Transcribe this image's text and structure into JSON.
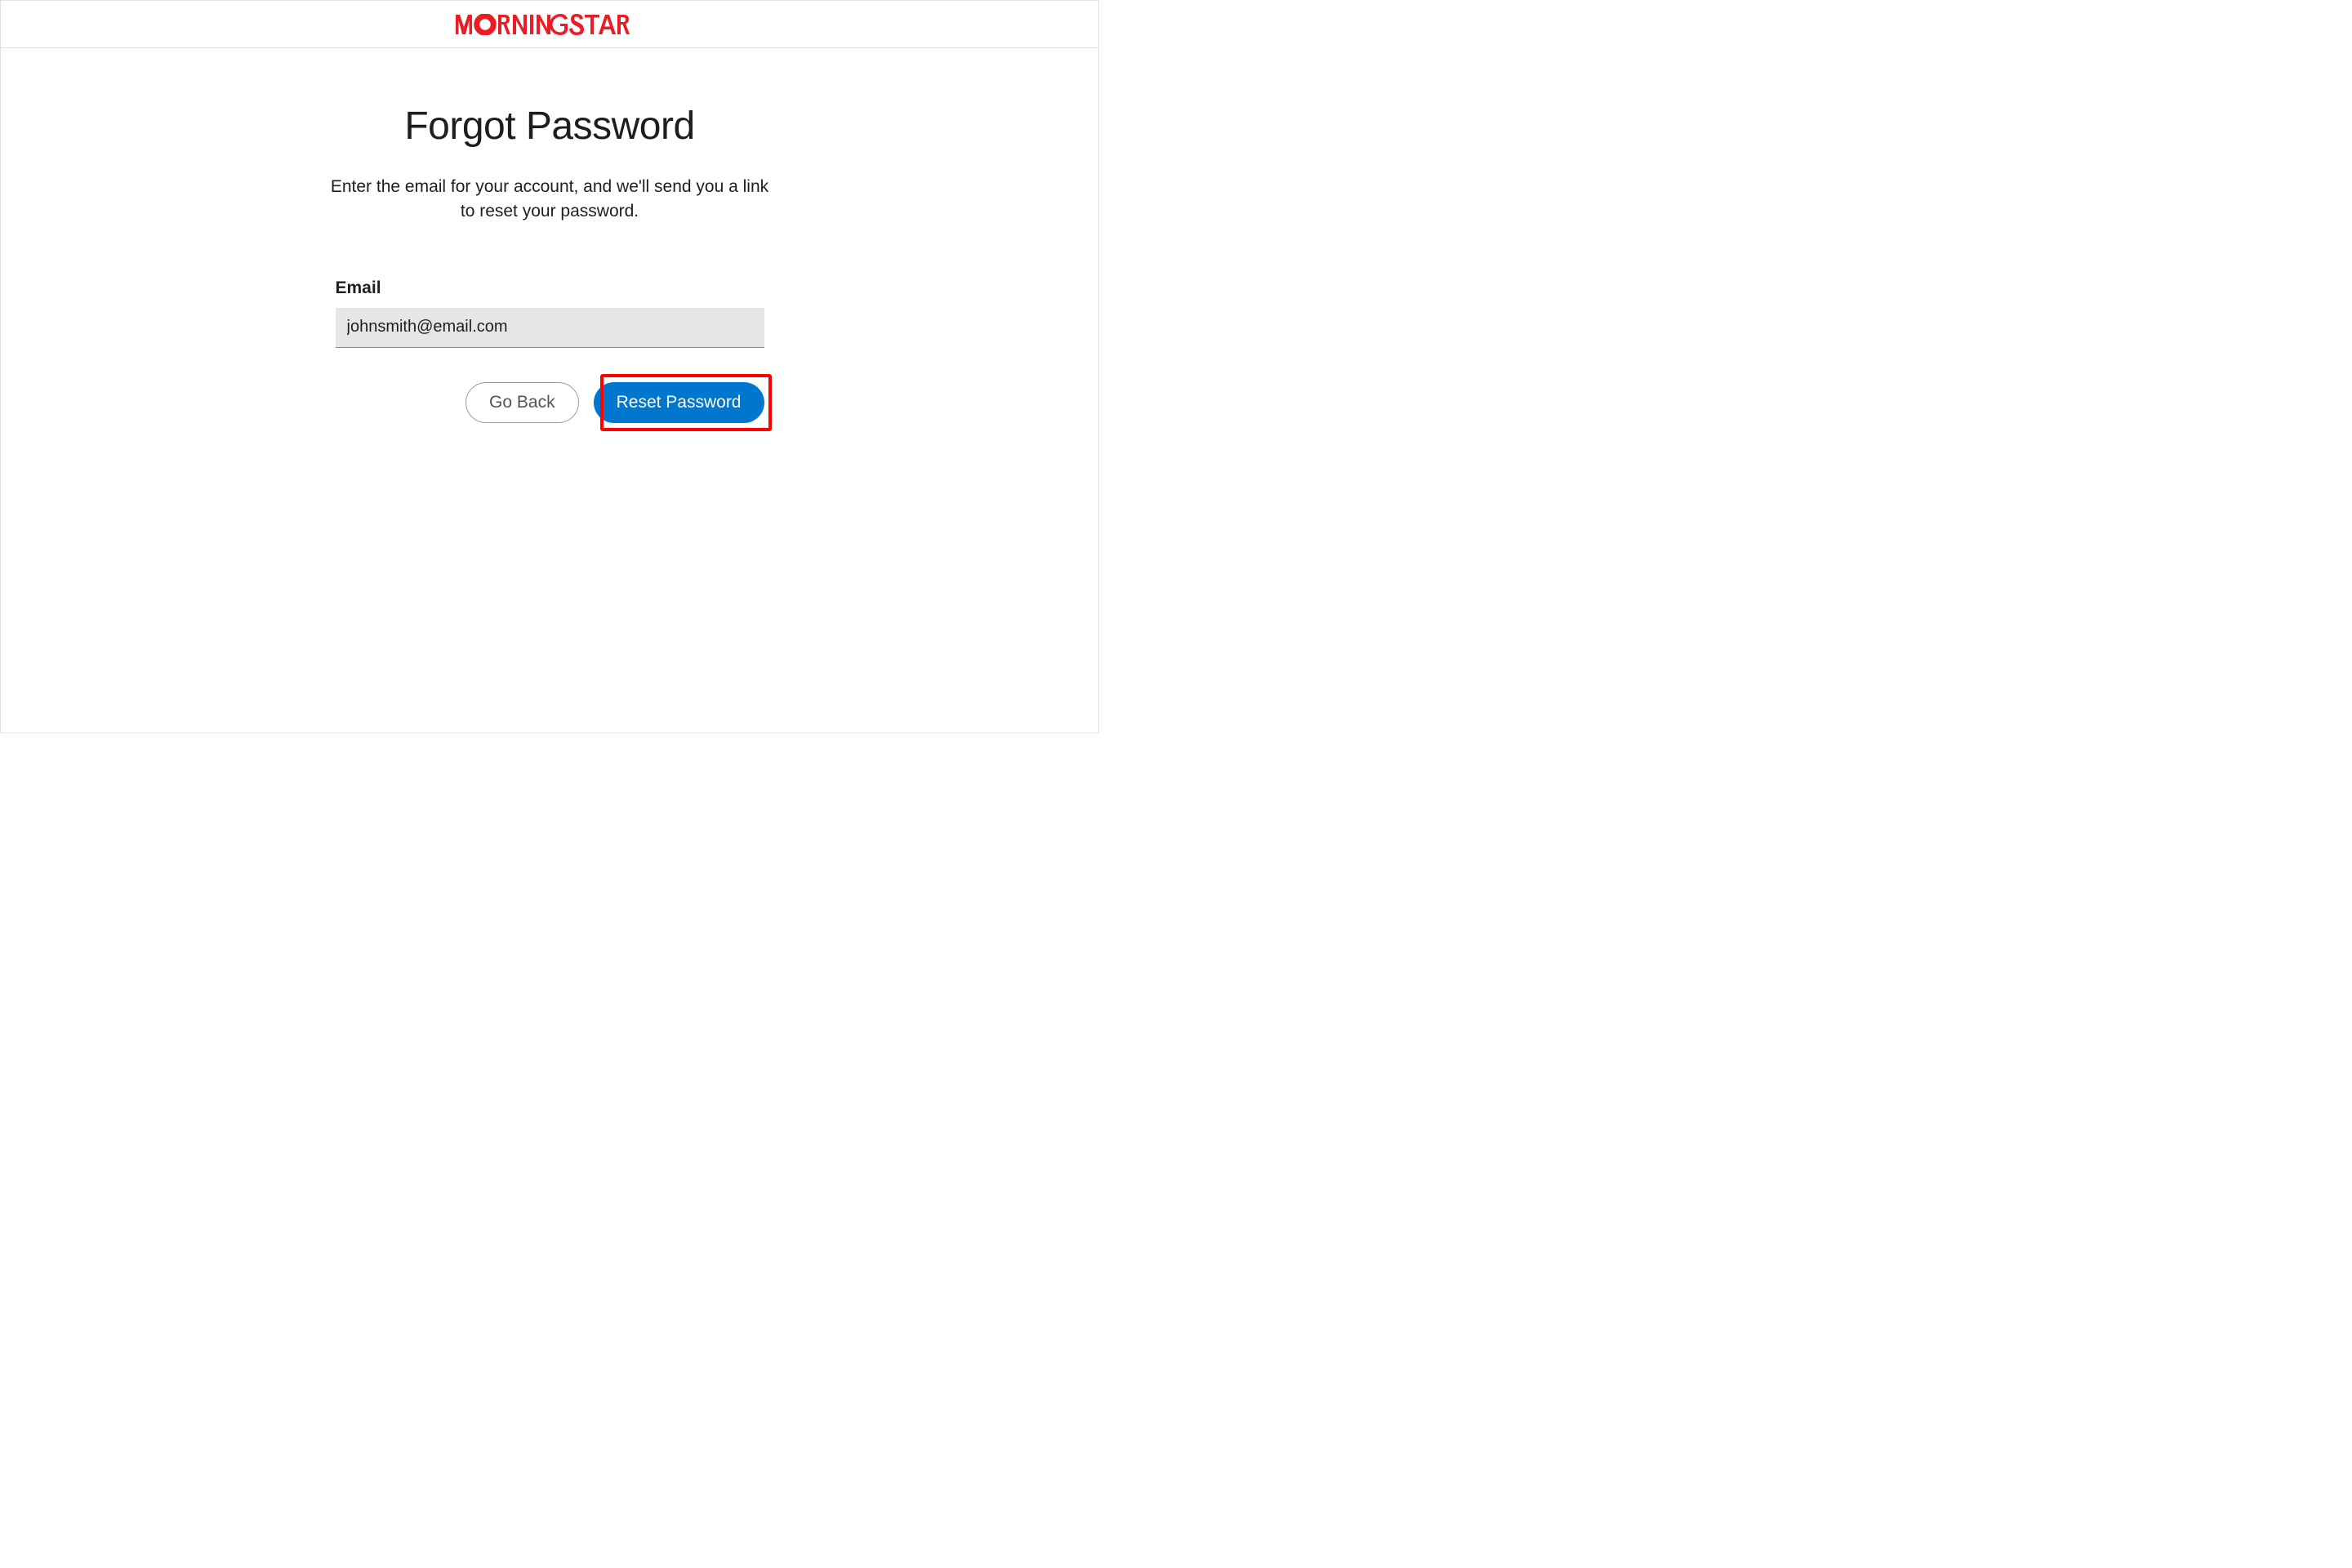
{
  "brand": {
    "name": "MORNINGSTAR",
    "color": "#ec1c24"
  },
  "page": {
    "title": "Forgot Password",
    "subtitle": "Enter the email for your account, and we'll send you a link to reset your password."
  },
  "form": {
    "email_label": "Email",
    "email_value": "johnsmith@email.com"
  },
  "buttons": {
    "go_back": "Go Back",
    "reset_password": "Reset Password"
  }
}
